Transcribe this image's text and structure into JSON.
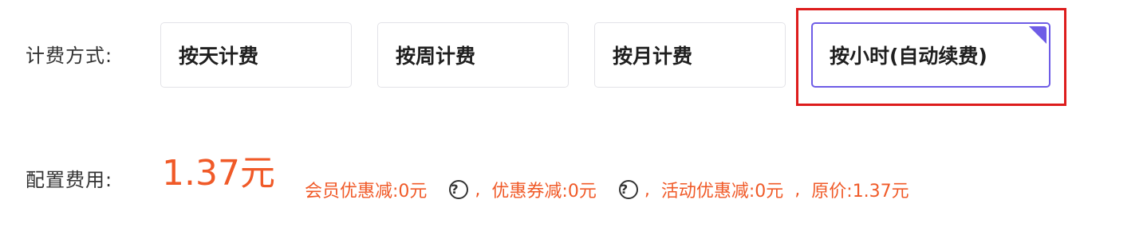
{
  "billing": {
    "label": "计费方式:",
    "options": [
      {
        "label": "按天计费",
        "selected": false
      },
      {
        "label": "按周计费",
        "selected": false
      },
      {
        "label": "按月计费",
        "selected": false
      },
      {
        "label": "按小时(自动续费)",
        "selected": true
      }
    ]
  },
  "config": {
    "label": "配置费用:",
    "price": "1.37元",
    "member_discount_label": "会员优惠减:",
    "member_discount_value": "0元",
    "coupon_discount_label": "优惠券减:",
    "coupon_discount_value": "0元",
    "activity_discount_label": "活动优惠减:",
    "activity_discount_value": "0元",
    "original_price_label": "原价:",
    "original_price_value": "1.37元",
    "separator": ",",
    "help_symbol": "?"
  },
  "colors": {
    "accent": "#6e5ce6",
    "price": "#f05a28",
    "highlight": "#dd1c1c"
  },
  "icons": {
    "help": "question-circle-icon",
    "selected_corner": "selected-corner-icon"
  }
}
